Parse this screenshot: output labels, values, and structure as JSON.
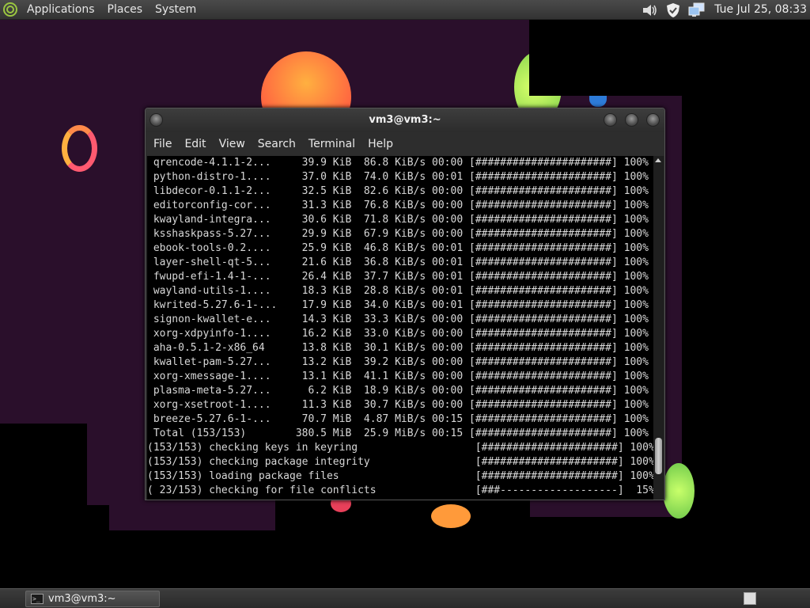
{
  "top_panel": {
    "menus": [
      {
        "label": "Applications"
      },
      {
        "label": "Places"
      },
      {
        "label": "System"
      }
    ],
    "clock": "Tue Jul 25, 08:33",
    "tray_icons": [
      "volume-icon",
      "shield-icon",
      "network-icon"
    ]
  },
  "terminal": {
    "title": "vm3@vm3:~",
    "menus": [
      {
        "label": "File"
      },
      {
        "label": "Edit"
      },
      {
        "label": "View"
      },
      {
        "label": "Search"
      },
      {
        "label": "Terminal"
      },
      {
        "label": "Help"
      }
    ],
    "lines": [
      {
        "text": " qrencode-4.1.1-2...     39.9 KiB  86.8 KiB/s 00:00 [######################] 100%"
      },
      {
        "text": " python-distro-1....     37.0 KiB  74.0 KiB/s 00:01 [######################] 100%"
      },
      {
        "text": " libdecor-0.1.1-2...     32.5 KiB  82.6 KiB/s 00:00 [######################] 100%"
      },
      {
        "text": " editorconfig-cor...     31.3 KiB  76.8 KiB/s 00:00 [######################] 100%"
      },
      {
        "text": " kwayland-integra...     30.6 KiB  71.8 KiB/s 00:00 [######################] 100%"
      },
      {
        "text": " ksshaskpass-5.27...     29.9 KiB  67.9 KiB/s 00:00 [######################] 100%"
      },
      {
        "text": " ebook-tools-0.2....     25.9 KiB  46.8 KiB/s 00:01 [######################] 100%"
      },
      {
        "text": " layer-shell-qt-5...     21.6 KiB  36.8 KiB/s 00:01 [######################] 100%"
      },
      {
        "text": " fwupd-efi-1.4-1-...     26.4 KiB  37.7 KiB/s 00:01 [######################] 100%"
      },
      {
        "text": " wayland-utils-1....     18.3 KiB  28.8 KiB/s 00:01 [######################] 100%"
      },
      {
        "text": " kwrited-5.27.6-1-...    17.9 KiB  34.0 KiB/s 00:01 [######################] 100%"
      },
      {
        "text": " signon-kwallet-e...     14.3 KiB  33.3 KiB/s 00:00 [######################] 100%"
      },
      {
        "text": " xorg-xdpyinfo-1....     16.2 KiB  33.0 KiB/s 00:00 [######################] 100%"
      },
      {
        "text": " aha-0.5.1-2-x86_64      13.8 KiB  30.1 KiB/s 00:00 [######################] 100%"
      },
      {
        "text": " kwallet-pam-5.27...     13.2 KiB  39.2 KiB/s 00:00 [######################] 100%"
      },
      {
        "text": " xorg-xmessage-1....     13.1 KiB  41.1 KiB/s 00:00 [######################] 100%"
      },
      {
        "text": " plasma-meta-5.27...      6.2 KiB  18.9 KiB/s 00:00 [######################] 100%"
      },
      {
        "text": " xorg-xsetroot-1....     11.3 KiB  30.7 KiB/s 00:00 [######################] 100%"
      },
      {
        "text": " breeze-5.27.6-1-...     70.7 MiB  4.87 MiB/s 00:15 [######################] 100%"
      },
      {
        "text": " Total (153/153)        380.5 MiB  25.9 MiB/s 00:15 [######################] 100%"
      },
      {
        "text": "(153/153) checking keys in keyring                   [######################] 100%"
      },
      {
        "text": "(153/153) checking package integrity                 [######################] 100%"
      },
      {
        "text": "(153/153) loading package files                      [######################] 100%"
      },
      {
        "text": "( 23/153) checking for file conflicts                [###-------------------]  15%"
      }
    ],
    "scroll_position": 0.92
  },
  "bottom_panel": {
    "task_label": "vm3@vm3:~",
    "task_icon": "terminal-icon",
    "workspace_icon": "workspace-switcher-icon"
  },
  "colors": {
    "wallpaper": "#2a0f2b",
    "terminal_text": "#d8d8d8",
    "terminal_bg": "#000000"
  }
}
